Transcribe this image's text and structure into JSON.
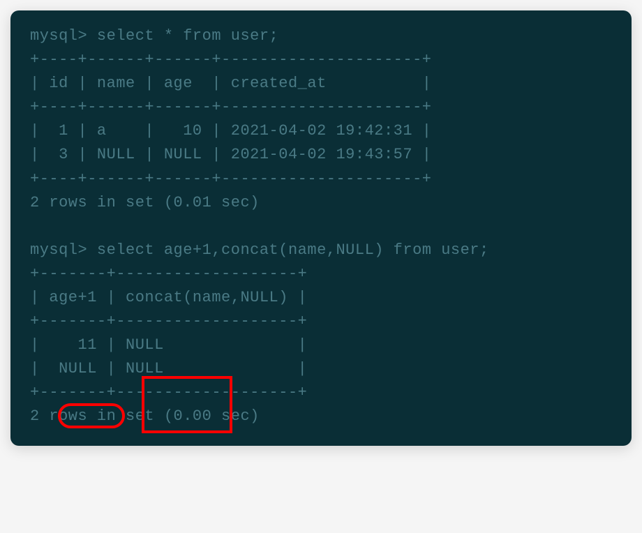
{
  "block1": {
    "query_line": "mysql> select * from user;",
    "border_top": "+----+------+------+---------------------+",
    "header": "| id | name | age  | created_at          |",
    "border_mid": "+----+------+------+---------------------+",
    "row1": "|  1 | a    |   10 | 2021-04-02 19:42:31 |",
    "row2": "|  3 | NULL | NULL | 2021-04-02 19:43:57 |",
    "border_bot": "+----+------+------+---------------------+",
    "footer": "2 rows in set (0.01 sec)"
  },
  "block2": {
    "query_line": "mysql> select age+1,concat(name,NULL) from user;",
    "border_top": "+-------+-------------------+",
    "header": "| age+1 | concat(name,NULL) |",
    "border_mid": "+-------+-------------------+",
    "row1": "|    11 | NULL              |",
    "row2": "|  NULL | NULL              |",
    "border_bot": "+-------+-------------------+",
    "footer": "2 rows in set (0.00 sec)"
  },
  "highlights": {
    "pill_null": "NULL (age+1 row2)",
    "box_nulls": "NULL concat column"
  },
  "chart_data": {
    "type": "table",
    "tables": [
      {
        "query": "select * from user;",
        "columns": [
          "id",
          "name",
          "age",
          "created_at"
        ],
        "rows": [
          {
            "id": 1,
            "name": "a",
            "age": 10,
            "created_at": "2021-04-02 19:42:31"
          },
          {
            "id": 3,
            "name": null,
            "age": null,
            "created_at": "2021-04-02 19:43:57"
          }
        ],
        "footer": "2 rows in set (0.01 sec)"
      },
      {
        "query": "select age+1,concat(name,NULL) from user;",
        "columns": [
          "age+1",
          "concat(name,NULL)"
        ],
        "rows": [
          {
            "age+1": 11,
            "concat(name,NULL)": null
          },
          {
            "age+1": null,
            "concat(name,NULL)": null
          }
        ],
        "footer": "2 rows in set (0.00 sec)"
      }
    ]
  }
}
